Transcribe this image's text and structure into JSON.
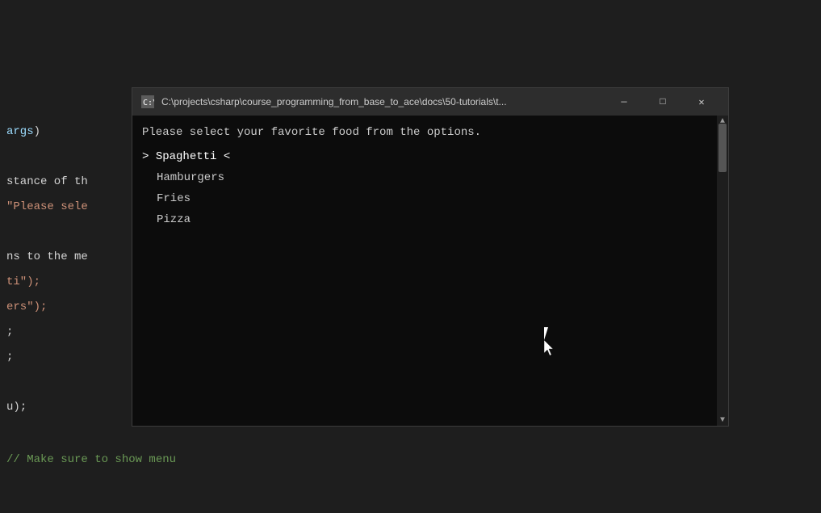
{
  "editor": {
    "background_color": "#1e1e1e",
    "code_lines": [
      {
        "text": "args)",
        "color": "cyan"
      },
      {
        "text": "",
        "color": "white"
      },
      {
        "text": "stance of th",
        "color": "white"
      },
      {
        "text": "\"Please sele",
        "color": "orange"
      },
      {
        "text": "",
        "color": "white"
      },
      {
        "text": "ns to the me",
        "color": "white"
      },
      {
        "text": "ti\");",
        "color": "orange"
      },
      {
        "text": "ers\");",
        "color": "orange"
      },
      {
        "text": ";",
        "color": "white"
      },
      {
        "text": ";",
        "color": "white"
      },
      {
        "text": "",
        "color": "white"
      },
      {
        "text": "u);",
        "color": "white"
      }
    ],
    "bottom_comment": "// Make sure to show menu"
  },
  "terminal": {
    "title": "C:\\projects\\csharp\\course_programming_from_base_to_ace\\docs\\50-tutorials\\t...",
    "title_icon": "terminal",
    "prompt_text": "Please select your favorite food from the options.",
    "menu_items": [
      {
        "label": "Spaghetti",
        "selected": true
      },
      {
        "label": "Hamburgers",
        "selected": false
      },
      {
        "label": "Fries",
        "selected": false
      },
      {
        "label": "Pizza",
        "selected": false
      }
    ],
    "selected_marker_left": "> ",
    "selected_marker_right": " <",
    "controls": {
      "minimize": "—",
      "maximize": "□",
      "close": "✕"
    }
  }
}
